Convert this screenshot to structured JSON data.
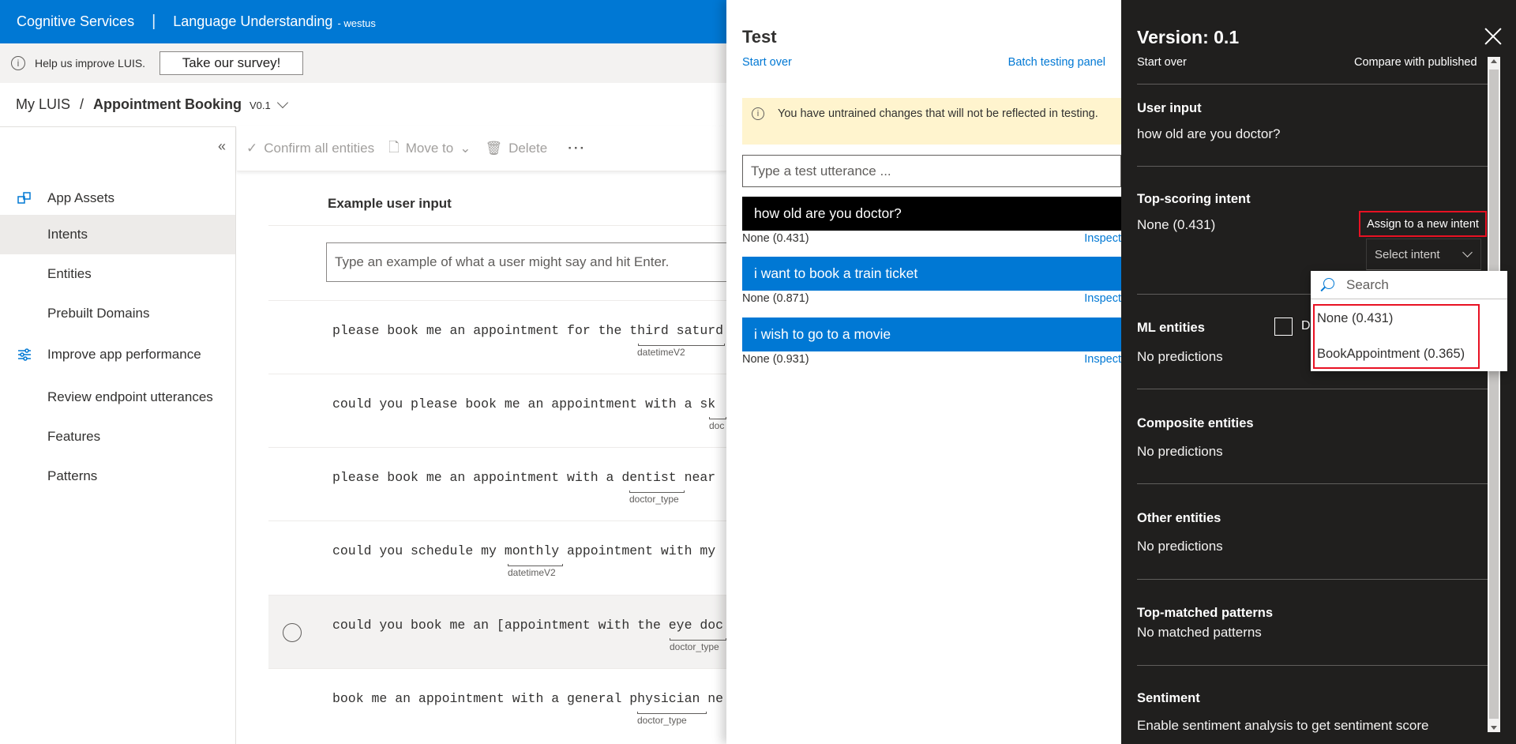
{
  "topbar": {
    "brand": "Cognitive Services",
    "separator": "|",
    "product": "Language Understanding",
    "region": "- westus"
  },
  "survey": {
    "text": "Help us improve LUIS.",
    "button": "Take our survey!"
  },
  "breadcrumb": {
    "root": "My LUIS",
    "slash": "/",
    "app": "Appointment Booking",
    "version": "V0.1"
  },
  "leftnav": {
    "collapse_icon": "double-chevron-left-icon",
    "items": [
      {
        "label": "App Assets",
        "icon": "app-assets-icon"
      },
      {
        "label": "Intents"
      },
      {
        "label": "Entities"
      },
      {
        "label": "Prebuilt Domains"
      },
      {
        "label": "Improve app performance",
        "icon": "sliders-icon"
      },
      {
        "label": "Review endpoint utterances"
      },
      {
        "label": "Features"
      },
      {
        "label": "Patterns"
      }
    ]
  },
  "toolbar": {
    "confirm": "Confirm all entities",
    "move": "Move to",
    "delete": "Delete",
    "more": "···"
  },
  "utterances": {
    "header": "Example user input",
    "placeholder": "Type an example of what a user might say and hit Enter.",
    "rows": [
      {
        "text": "please book me an appointment for the third saturd",
        "tag": "datetimeV2"
      },
      {
        "text": "could you please book me an appointment with a sk",
        "tag": "doc"
      },
      {
        "text": "please book me an appointment with a dentist near",
        "tag": "doctor_type"
      },
      {
        "text": "could you schedule my monthly appointment with my",
        "tag": "datetimeV2"
      },
      {
        "text": "could you book me an [appointment with the eye doc",
        "tag": "doctor_type"
      },
      {
        "text": "book me an appointment with a general physician ne",
        "tag": "doctor_type"
      }
    ]
  },
  "test": {
    "title": "Test",
    "start_over": "Start over",
    "batch": "Batch testing panel",
    "warning": "You have untrained changes that will not be reflected in testing.",
    "input_placeholder": "Type a test utterance ...",
    "results": [
      {
        "text": "how old are you doctor?",
        "score": "None (0.431)",
        "inspect": "Inspect"
      },
      {
        "text": "i want to book a train ticket",
        "score": "None (0.871)",
        "inspect": "Inspect"
      },
      {
        "text": "i wish to go to a movie",
        "score": "None (0.931)",
        "inspect": "Inspect"
      }
    ]
  },
  "inspect": {
    "title": "Version: 0.1",
    "start_over": "Start over",
    "compare": "Compare with published",
    "user_input_label": "User input",
    "user_input_value": "how old are you doctor?",
    "top_intent_label": "Top-scoring intent",
    "top_intent_value": "None (0.431)",
    "assign_btn": "Assign to a new intent",
    "select_intent": "Select intent",
    "ml_label": "ML entities",
    "ml_check_label": "D",
    "ml_value": "No predictions",
    "composite_label": "Composite entities",
    "composite_value": "No predictions",
    "other_label": "Other entities",
    "other_value": "No predictions",
    "patterns_label": "Top-matched patterns",
    "patterns_value": "No matched patterns",
    "sentiment_label": "Sentiment",
    "sentiment_value": "Enable sentiment analysis to get sentiment score"
  },
  "dropdown": {
    "search_placeholder": "Search",
    "options": [
      "None (0.431)",
      "BookAppointment (0.365)"
    ]
  }
}
